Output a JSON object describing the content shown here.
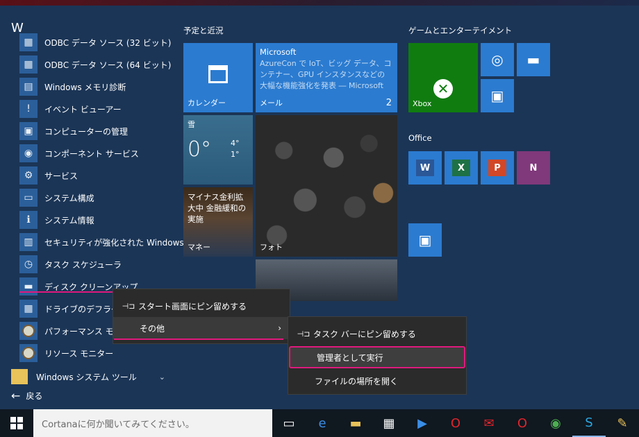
{
  "start": {
    "letter": "W",
    "apps": [
      {
        "label": "ODBC データ ソース (32 ビット)",
        "icon": "odbc-icon"
      },
      {
        "label": "ODBC データ ソース (64 ビット)",
        "icon": "odbc-icon"
      },
      {
        "label": "Windows メモリ診断",
        "icon": "memory-diagnostic-icon"
      },
      {
        "label": "イベント ビューアー",
        "icon": "event-viewer-icon"
      },
      {
        "label": "コンピューターの管理",
        "icon": "computer-management-icon"
      },
      {
        "label": "コンポーネント サービス",
        "icon": "component-services-icon"
      },
      {
        "label": "サービス",
        "icon": "services-gear-icon"
      },
      {
        "label": "システム構成",
        "icon": "system-config-icon"
      },
      {
        "label": "システム情報",
        "icon": "system-info-icon"
      },
      {
        "label": "セキュリティが強化された Windows...",
        "icon": "firewall-icon"
      },
      {
        "label": "タスク スケジューラ",
        "icon": "task-scheduler-icon"
      },
      {
        "label": "ディスク クリーンアップ",
        "icon": "disk-cleanup-icon"
      },
      {
        "label": "ドライブのデフラグと最",
        "icon": "defrag-icon"
      },
      {
        "label": "パフォーマンス モニター",
        "icon": "performance-monitor-icon"
      },
      {
        "label": "リソース モニター",
        "icon": "resource-monitor-icon"
      }
    ],
    "group": {
      "label": "Windows システム ツール",
      "chevron": "⌄"
    },
    "back": {
      "label": "戻る",
      "arrow": "←"
    }
  },
  "tiles": {
    "sec1": "予定と近況",
    "sec2": "ゲームとエンターテイメント",
    "sec3": "Office",
    "calendar": "カレンダー",
    "mail": {
      "source": "Microsoft",
      "body": "AzureCon で IoT、ビッグ データ、コンテナー、GPU インスタンスなどの大幅な機能強化を発表 ― Microsoft",
      "label": "メール",
      "count": "2"
    },
    "weather": {
      "label": "雪",
      "temp": "0°",
      "hi": "4°",
      "lo": "1°"
    },
    "money": {
      "headline": "マイナス金利拡大中 金融緩和の実施",
      "label": "マネー"
    },
    "photo": {
      "label": "フォト"
    },
    "xbox": {
      "label": "Xbox"
    }
  },
  "ctx1": {
    "pin": "スタート画面にピン留めする",
    "more": "その他",
    "submenu_arrow": "›"
  },
  "ctx2": {
    "pin": "タスク バーにピン留めする",
    "admin": "管理者として実行",
    "folder": "ファイルの場所を開く"
  },
  "taskbar": {
    "search_placeholder": "Cortanaに何か聞いてみてください。"
  },
  "colors": {
    "accent": "#2b7bd0",
    "highlight": "#e0197d",
    "xbox": "#107c10",
    "onenote": "#80397b"
  }
}
